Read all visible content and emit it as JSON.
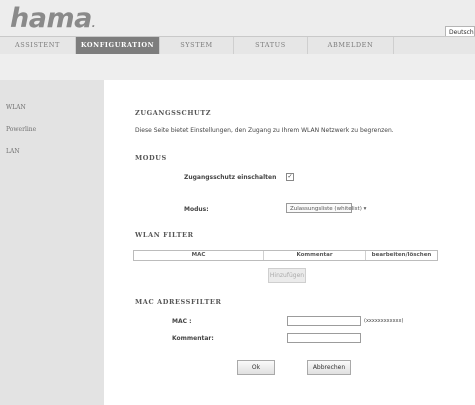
{
  "brand": {
    "logo_text": "hama",
    "logo_dot": "."
  },
  "language": {
    "selected": "Deutsch ▾"
  },
  "nav": {
    "tabs": [
      {
        "label": "ASSISTENT"
      },
      {
        "label": "KONFIGURATION"
      },
      {
        "label": "SYSTEM"
      },
      {
        "label": "STATUS"
      },
      {
        "label": "ABMELDEN"
      }
    ]
  },
  "sidebar": {
    "items": [
      {
        "label": "WLAN"
      },
      {
        "label": "Powerline"
      },
      {
        "label": "LAN"
      }
    ]
  },
  "page": {
    "title": "ZUGANGSSCHUTZ",
    "description": "Diese Seite bietet Einstellungen, den Zugang zu Ihrem WLAN Netzwerk zu begrenzen."
  },
  "modus": {
    "heading": "MODUS",
    "enable_label": "Zugangsschutz einschalten",
    "enable_checked_mark": "✓",
    "mode_label": "Modus:",
    "mode_value": "Zulassungsliste (whitelist) ▾"
  },
  "wlan_filter": {
    "heading": "WLAN FILTER",
    "columns": [
      "MAC",
      "Kommentar",
      "bearbeiten/löschen"
    ],
    "add_button": "Hinzufügen"
  },
  "mac_filter": {
    "heading": "MAC ADRESSFILTER",
    "mac_label": "MAC :",
    "mac_hint": "(xxxxxxxxxxxx)",
    "comment_label": "Kommentar:"
  },
  "actions": {
    "ok": "Ok",
    "cancel": "Abbrechen"
  }
}
